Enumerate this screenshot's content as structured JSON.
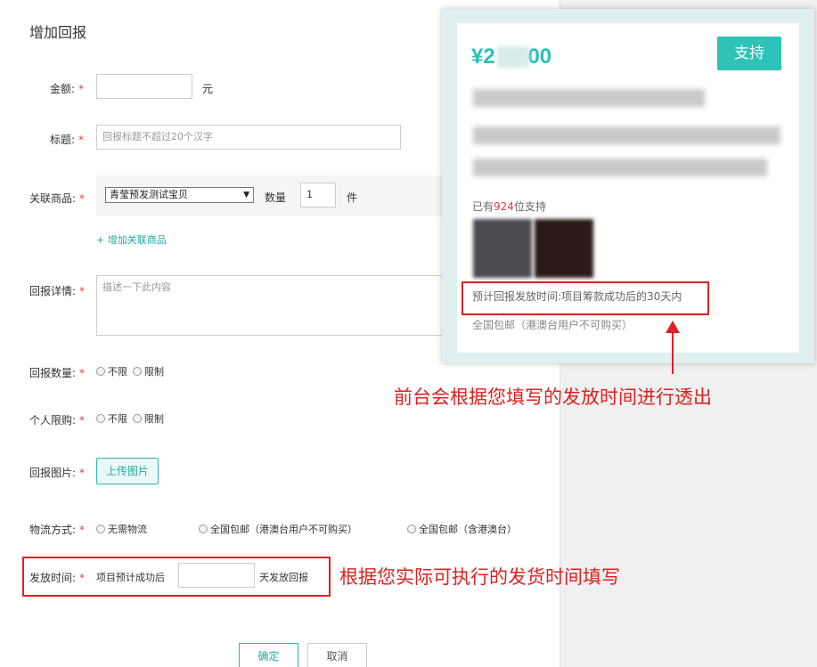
{
  "page": {
    "title": "增加回报"
  },
  "form": {
    "amount": {
      "label": "金额:",
      "star": "*",
      "unit": "元",
      "value": ""
    },
    "title": {
      "label": "标题:",
      "star": "*",
      "placeholder": "回报标题不超过20个汉字"
    },
    "product": {
      "label": "关联商品:",
      "star": "*",
      "selected": "青莹预发测试宝贝",
      "qty_label": "数量",
      "qty_value": "1",
      "qty_unit": "件",
      "add_link": "+ 增加关联商品"
    },
    "details": {
      "label": "回报详情:",
      "star": "*",
      "placeholder": "描述一下此内容"
    },
    "reward_qty": {
      "label": "回报数量:",
      "star": "*",
      "options": [
        "不限",
        "限制"
      ]
    },
    "personal_limit": {
      "label": "个人限购:",
      "star": "*",
      "options": [
        "不限",
        "限制"
      ]
    },
    "image": {
      "label": "回报图片:",
      "star": "*",
      "upload_label": "上传图片"
    },
    "logistics": {
      "label": "物流方式:",
      "star": "*",
      "options": [
        "无需物流",
        "全国包邮（港澳台用户不可购买）",
        "全国包邮（含港澳台）"
      ]
    },
    "ship_time": {
      "label": "发放时间:",
      "star": "*",
      "prefix": "项目预计成功后",
      "value": "",
      "suffix": "天发放回报"
    },
    "confirm_label": "确定",
    "cancel_label": "取消"
  },
  "preview": {
    "price_prefix": "¥2",
    "price_suffix": ".00",
    "support_label": "支持",
    "support_count_prefix": "已有",
    "support_count": "924",
    "support_count_suffix": "位支持",
    "time_text": "预计回报发放时间:项目筹款成功后的30天内",
    "shipping_text": "全国包邮（港澳台用户不可购买）"
  },
  "annotations": {
    "preview_note": "前台会根据您填写的发放时间进行透出",
    "form_note": "根据您实际可执行的发货时间填写"
  },
  "colors": {
    "accent": "#27a9a1",
    "annotation_red": "#e02020",
    "required_star": "#e4393c"
  }
}
